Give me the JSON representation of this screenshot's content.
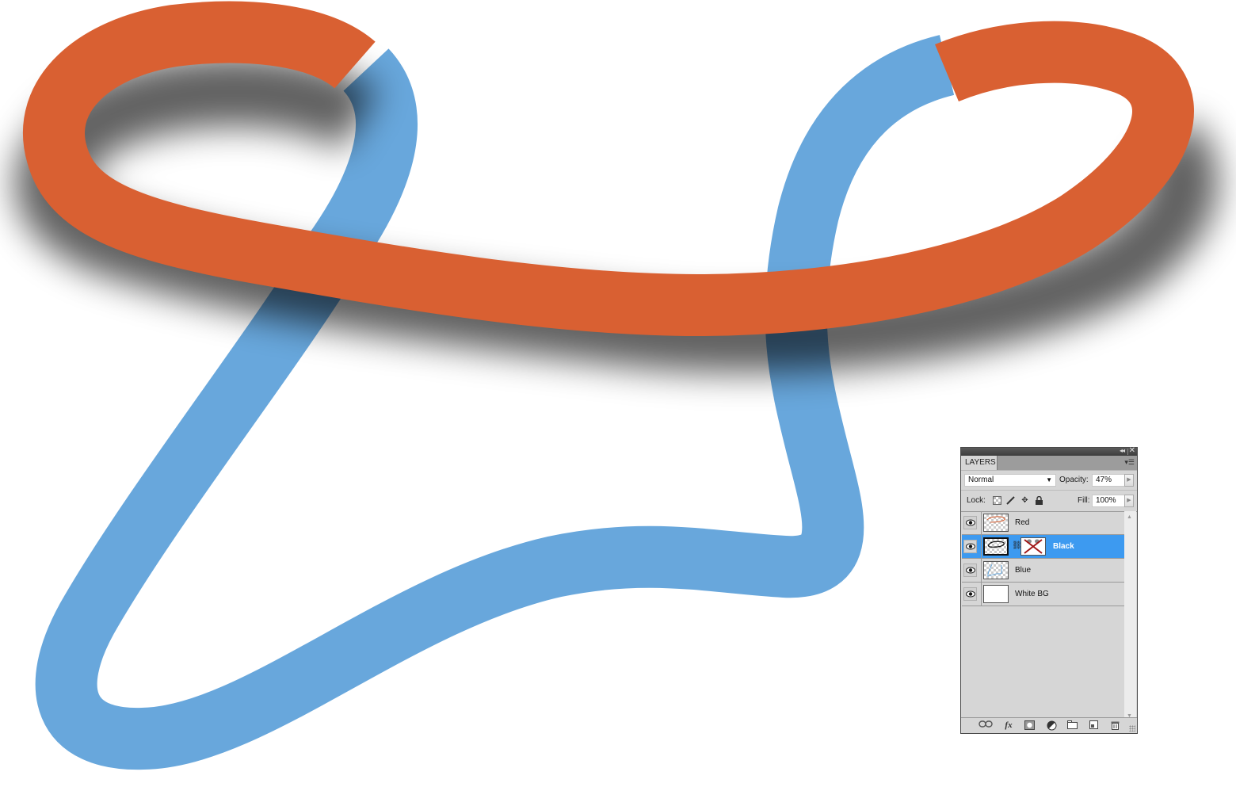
{
  "canvas": {
    "colors": {
      "background": "#ffffff",
      "red_stroke": "#d96032",
      "blue_stroke": "#68a7dc",
      "shadow": "#7f7f7f",
      "shadow_on_blue": "#3a5f80"
    },
    "strokes": [
      {
        "name": "red-ribbon",
        "layer": "Red"
      },
      {
        "name": "blue-ribbon",
        "layer": "Blue"
      },
      {
        "name": "black-shadow",
        "layer": "Black"
      }
    ]
  },
  "layers_panel": {
    "tab_label": "LAYERS",
    "blend_mode": "Normal",
    "opacity_label": "Opacity:",
    "opacity_value": "47%",
    "lock_label": "Lock:",
    "fill_label": "Fill:",
    "fill_value": "100%",
    "selected_color": "#3d9af0",
    "layers": [
      {
        "name": "Red",
        "visible": true,
        "selected": false,
        "has_mask": false
      },
      {
        "name": "Black",
        "visible": true,
        "selected": true,
        "has_mask": true
      },
      {
        "name": "Blue",
        "visible": true,
        "selected": false,
        "has_mask": false
      },
      {
        "name": "White BG",
        "visible": true,
        "selected": false,
        "has_mask": false
      }
    ],
    "bottom_icons": [
      "link-layers-icon",
      "fx-icon",
      "add-mask-icon",
      "adjustment-layer-icon",
      "new-group-icon",
      "new-layer-icon",
      "trash-icon"
    ],
    "fx_label": "fx"
  }
}
